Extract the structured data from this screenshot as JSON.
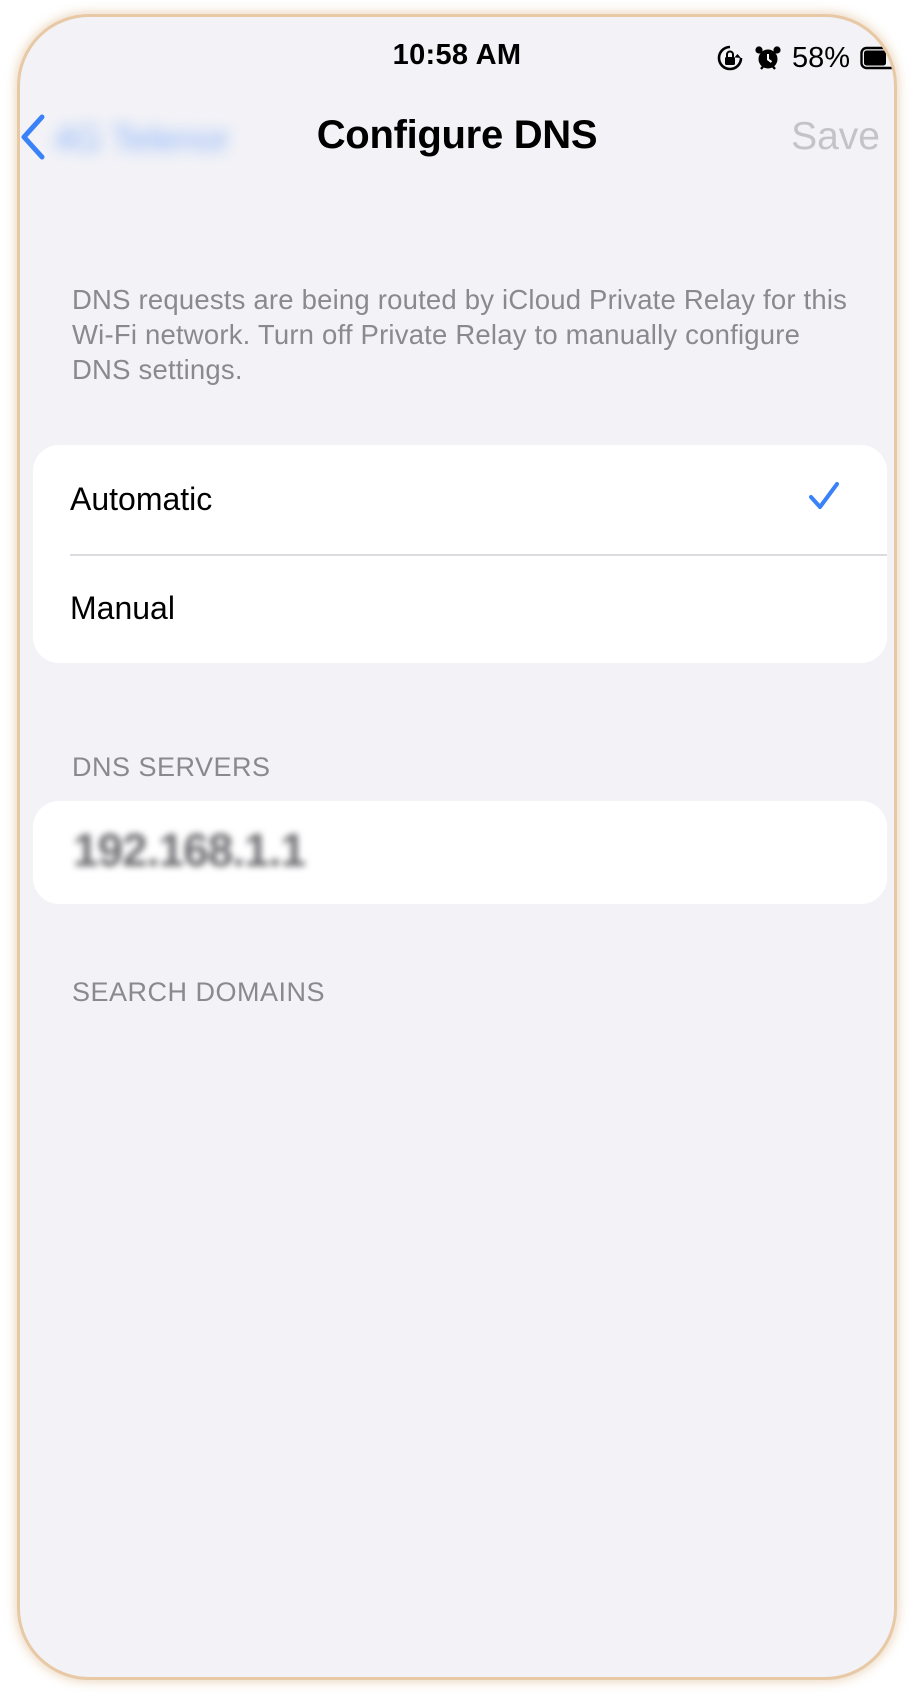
{
  "status_bar": {
    "time": "10:58 AM",
    "battery_percent": "58%",
    "icons": [
      "orientation-lock-icon",
      "alarm-icon",
      "battery-icon"
    ],
    "battery_level": 0.58
  },
  "nav": {
    "back_label": "4G Telenor",
    "title": "Configure DNS",
    "save_label": "Save",
    "accent_color": "#3a82f7",
    "disabled_color": "#c4c4c8"
  },
  "info": {
    "text": "DNS requests are being routed by iCloud Private Relay for this Wi-Fi network. Turn off Private Relay to manually configure DNS settings."
  },
  "mode_options": {
    "items": [
      {
        "label": "Automatic",
        "selected": true
      },
      {
        "label": "Manual",
        "selected": false
      }
    ]
  },
  "dns_servers": {
    "header": "DNS SERVERS",
    "items": [
      "192.168.1.1"
    ]
  },
  "search_domains": {
    "header": "SEARCH DOMAINS"
  }
}
